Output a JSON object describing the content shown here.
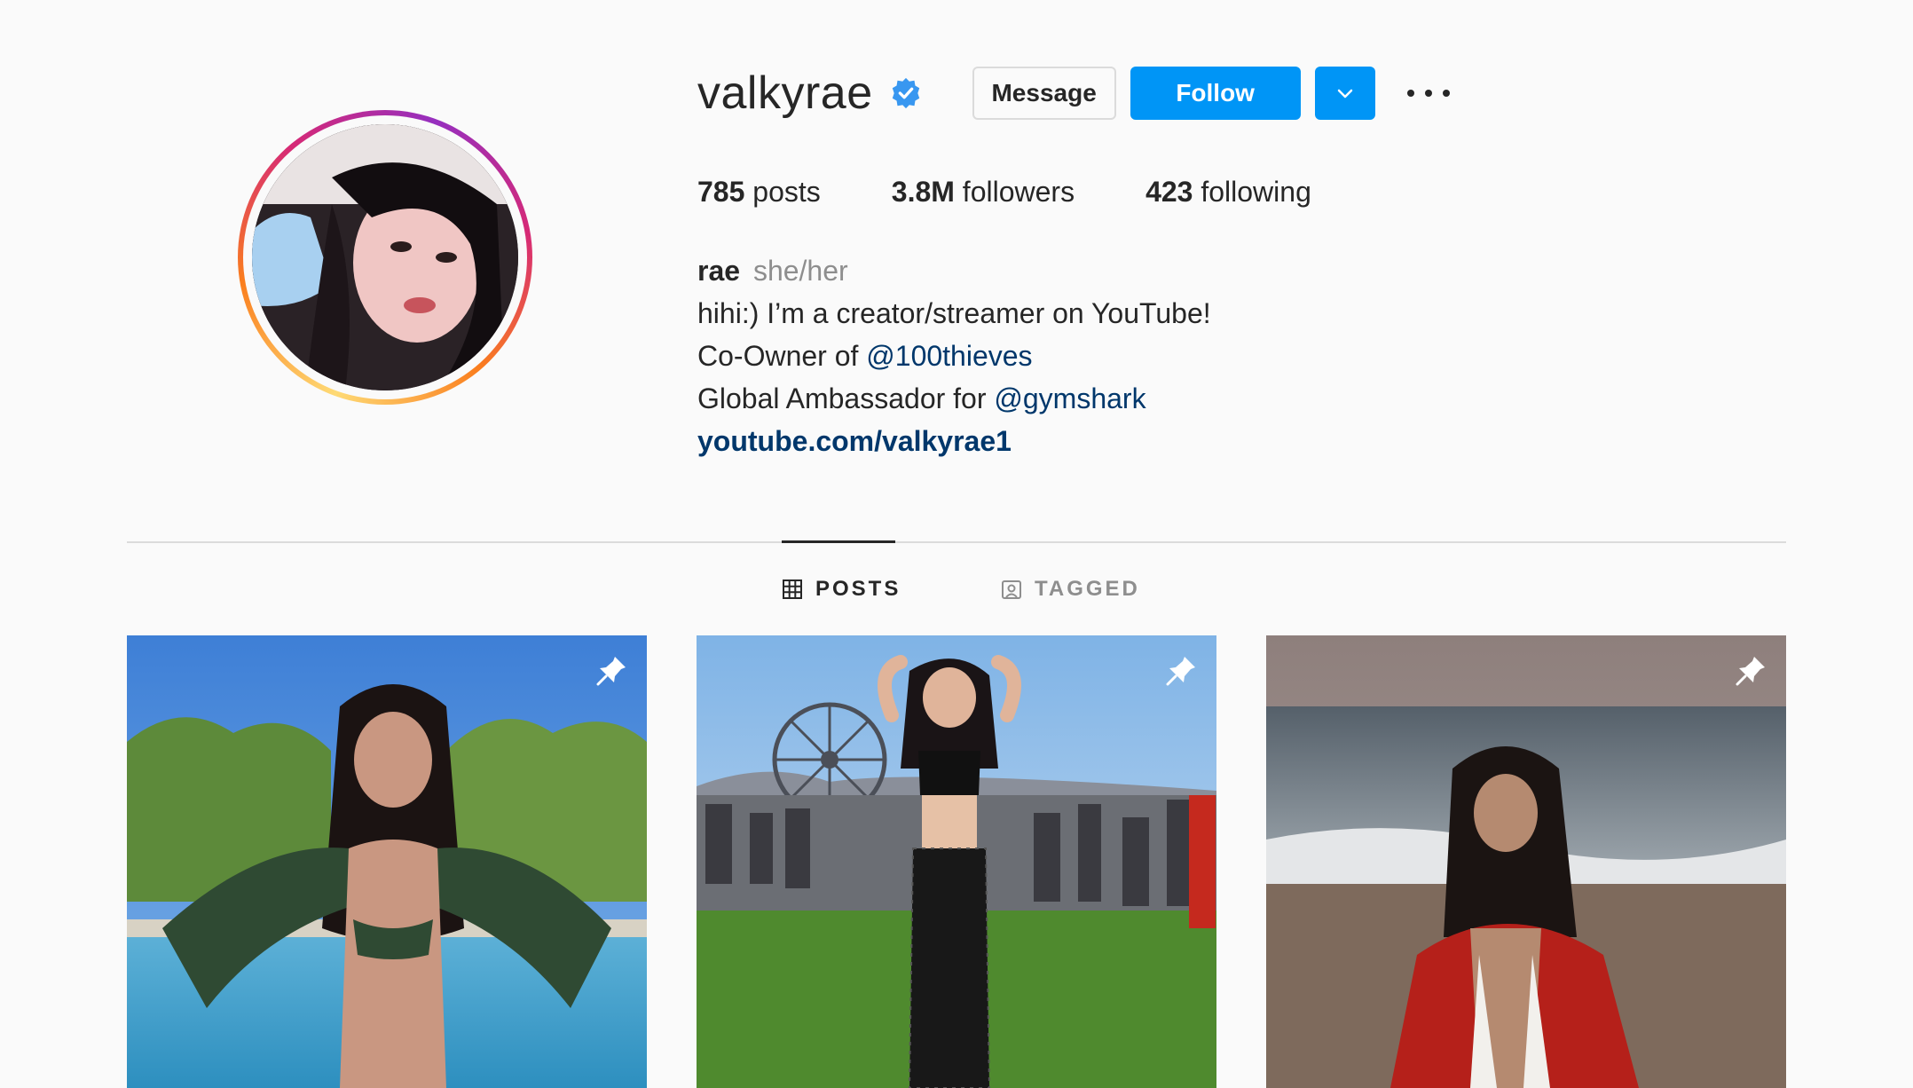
{
  "profile": {
    "username": "valkyrae",
    "message_label": "Message",
    "follow_label": "Follow",
    "stats": {
      "posts_count": "785",
      "posts_label": "posts",
      "followers_count": "3.8M",
      "followers_label": "followers",
      "following_count": "423",
      "following_label": "following"
    },
    "bio": {
      "name": "rae",
      "pronouns": "she/her",
      "line1": "hihi:) I’m a creator/streamer on YouTube!",
      "line2_prefix": "Co-Owner of ",
      "line2_mention": "@100thieves",
      "line3_prefix": "Global Ambassador for ",
      "line3_mention": "@gymshark",
      "website": "youtube.com/valkyrae1"
    }
  },
  "tabs": {
    "posts": "POSTS",
    "tagged": "TAGGED"
  },
  "colors": {
    "accent": "#0095f6",
    "verified": "#3897f0",
    "link": "#00376b",
    "muted": "#8e8e8e",
    "text": "#262626",
    "background": "#fafafa"
  },
  "icons": {
    "verified": "verified-badge-icon",
    "dropdown": "chevron-down-icon",
    "more": "more-options-icon",
    "posts_tab": "grid-icon",
    "tagged_tab": "tagged-user-icon",
    "pinned": "pin-icon"
  }
}
